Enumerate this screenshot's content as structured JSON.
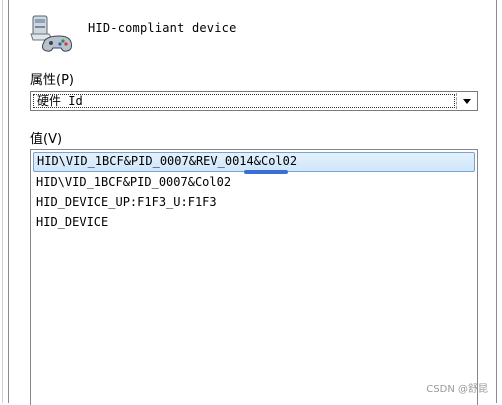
{
  "device": {
    "name": "HID-compliant device",
    "icon": "hid-device-icon"
  },
  "property": {
    "label": "属性(P)",
    "selected_value": "硬件 Id"
  },
  "value": {
    "label": "值(V)",
    "items": [
      "HID\\VID_1BCF&PID_0007&REV_0014&Col02",
      "HID\\VID_1BCF&PID_0007&Col02",
      "HID_DEVICE_UP:F1F3_U:F1F3",
      "HID_DEVICE"
    ],
    "selected_index": 0
  },
  "watermark": "CSDN @舒昆",
  "colors": {
    "selection_border": "#7da2ce",
    "selection_fill": "#cfe6fb",
    "squiggle": "#3a6fd6"
  }
}
